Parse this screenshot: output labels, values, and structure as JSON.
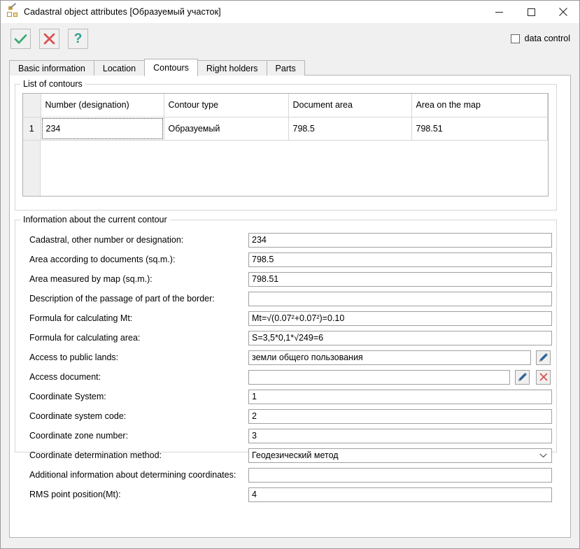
{
  "window": {
    "title": "Cadastral object attributes [Образуемый участок]",
    "app_icon": "cadastral-app-icon",
    "controls": {
      "minimize": "minimize-icon",
      "maximize": "maximize-icon",
      "close": "close-icon"
    }
  },
  "toolbar": {
    "ok_label": "ok-check-icon",
    "cancel_label": "cancel-cross-icon",
    "help_label": "?",
    "data_control_label": "data control",
    "data_control_checked": false
  },
  "tabs": [
    {
      "label": "Basic information",
      "active": false
    },
    {
      "label": "Location",
      "active": false
    },
    {
      "label": "Contours",
      "active": true
    },
    {
      "label": "Right holders",
      "active": false
    },
    {
      "label": "Parts",
      "active": false
    }
  ],
  "contours_group": {
    "legend": "List of contours",
    "columns": [
      "",
      "Number (designation)",
      "Contour type",
      "Document area",
      "Area on the map"
    ],
    "rows": [
      {
        "index": "1",
        "number": "234",
        "contour_type": "Образуемый",
        "document_area": "798.5",
        "area_on_map": "798.51"
      }
    ]
  },
  "info_group": {
    "legend": "Information about the current contour",
    "fields": [
      {
        "label": "Cadastral, other number or designation:",
        "value": "234"
      },
      {
        "label": "Area according to documents (sq.m.):",
        "value": "798.5"
      },
      {
        "label": "Area measured by map (sq.m.):",
        "value": "798.51"
      },
      {
        "label": "Description of the passage of part of the border:",
        "value": ""
      },
      {
        "label": "Formula for calculating Mt:",
        "value": "Mt=√(0.07²+0.07²)=0.10"
      },
      {
        "label": "Formula for calculating area:",
        "value": "S=3,5*0,1*√249=6"
      },
      {
        "label": "Access to public lands:",
        "value": "земли общего пользования"
      },
      {
        "label": "Access document:",
        "value": ""
      },
      {
        "label": "Coordinate System:",
        "value": "1"
      },
      {
        "label": "Coordinate system code:",
        "value": "2"
      },
      {
        "label": "Coordinate zone number:",
        "value": "3"
      },
      {
        "label": "Coordinate determination method:",
        "value": "Геодезический метод"
      },
      {
        "label": "Additional information about determining coordinates:",
        "value": ""
      },
      {
        "label": "RMS point position(Mt):",
        "value": "4"
      }
    ]
  },
  "colors": {
    "accent_green": "#3aa86e",
    "accent_red": "#d9534f",
    "accent_teal": "#2c9e8f",
    "pen_blue": "#2a6ebb",
    "window_bg": "#f0f0f0",
    "panel_bg": "#ffffff"
  }
}
